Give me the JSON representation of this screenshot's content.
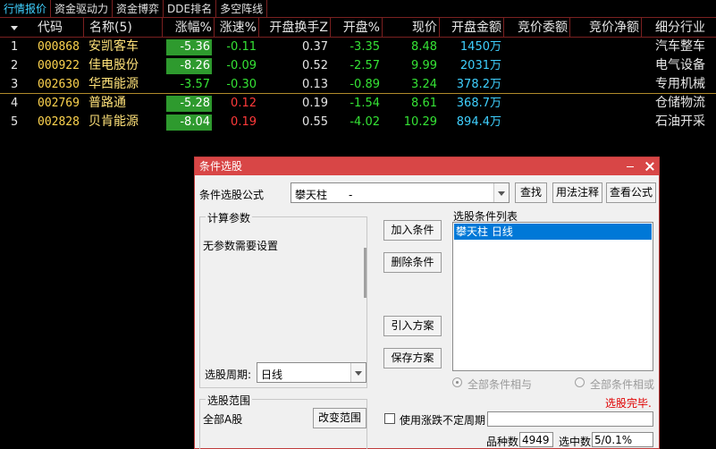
{
  "tabs": [
    "行情报价",
    "资金驱动力",
    "资金博弈",
    "DDE排名",
    "多空阵线"
  ],
  "table": {
    "headers": {
      "code": "代码",
      "name": "名称(5)",
      "change_pct": "涨幅%",
      "speed_pct": "涨速%",
      "open_turnover": "开盘换手Z",
      "open_pct": "开盘%",
      "price": "现价",
      "open_amount": "开盘金额",
      "bid_commission": "竞价委额",
      "bid_net": "竞价净额",
      "industry": "细分行业"
    },
    "rows": [
      {
        "idx": "1",
        "code": "000868",
        "name": "安凯客车",
        "change_pct": "-5.36",
        "speed_pct": "-0.11",
        "open_turnover": "0.37",
        "open_pct": "-3.35",
        "price": "8.48",
        "open_amount": "1450万",
        "industry": "汽车整车"
      },
      {
        "idx": "2",
        "code": "000922",
        "name": "佳电股份",
        "change_pct": "-8.26",
        "speed_pct": "-0.09",
        "open_turnover": "0.52",
        "open_pct": "-2.57",
        "price": "9.99",
        "open_amount": "2031万",
        "industry": "电气设备"
      },
      {
        "idx": "3",
        "code": "002630",
        "name": "华西能源",
        "change_pct": "-3.57",
        "speed_pct": "-0.30",
        "open_turnover": "0.13",
        "open_pct": "-0.89",
        "price": "3.24",
        "open_amount": "378.2万",
        "industry": "专用机械"
      },
      {
        "idx": "4",
        "code": "002769",
        "name": "普路通",
        "change_pct": "-5.28",
        "speed_pct": "0.12",
        "open_turnover": "0.19",
        "open_pct": "-1.54",
        "price": "8.61",
        "open_amount": "368.7万",
        "industry": "仓储物流"
      },
      {
        "idx": "5",
        "code": "002828",
        "name": "贝肯能源",
        "change_pct": "-8.04",
        "speed_pct": "0.19",
        "open_turnover": "0.55",
        "open_pct": "-4.02",
        "price": "10.29",
        "open_amount": "894.4万",
        "industry": "石油开采"
      }
    ]
  },
  "dialog": {
    "title": "条件选股",
    "formula_label": "条件选股公式",
    "formula_value": "攀天柱　　-",
    "btn_find": "查找",
    "btn_usage": "用法注释",
    "btn_view": "查看公式",
    "params_title": "计算参数",
    "params_text": "无参数需要设置",
    "period_label": "选股周期:",
    "period_value": "日线",
    "btn_add": "加入条件",
    "btn_delete": "删除条件",
    "btn_import": "引入方案",
    "btn_save": "保存方案",
    "list_title": "选股条件列表",
    "list_items": [
      "攀天柱  日线"
    ],
    "radio_and": "全部条件相与",
    "radio_or": "全部条件相或",
    "status": "选股完毕.",
    "range_title": "选股范围",
    "range_value": "全部A股",
    "btn_change_range": "改变范围",
    "checkbox_label": "使用涨跌不定周期",
    "count_label": "品种数",
    "count_value": "4949",
    "selected_label": "选中数",
    "selected_value": "5/0.1%"
  },
  "colors": {
    "header_line": "#7a2020",
    "dialog_title_bar": "#d84646",
    "selection": "#0078d7",
    "down_green": "#35e335",
    "up_red": "#ff3a3a",
    "status_red": "#e00000"
  }
}
